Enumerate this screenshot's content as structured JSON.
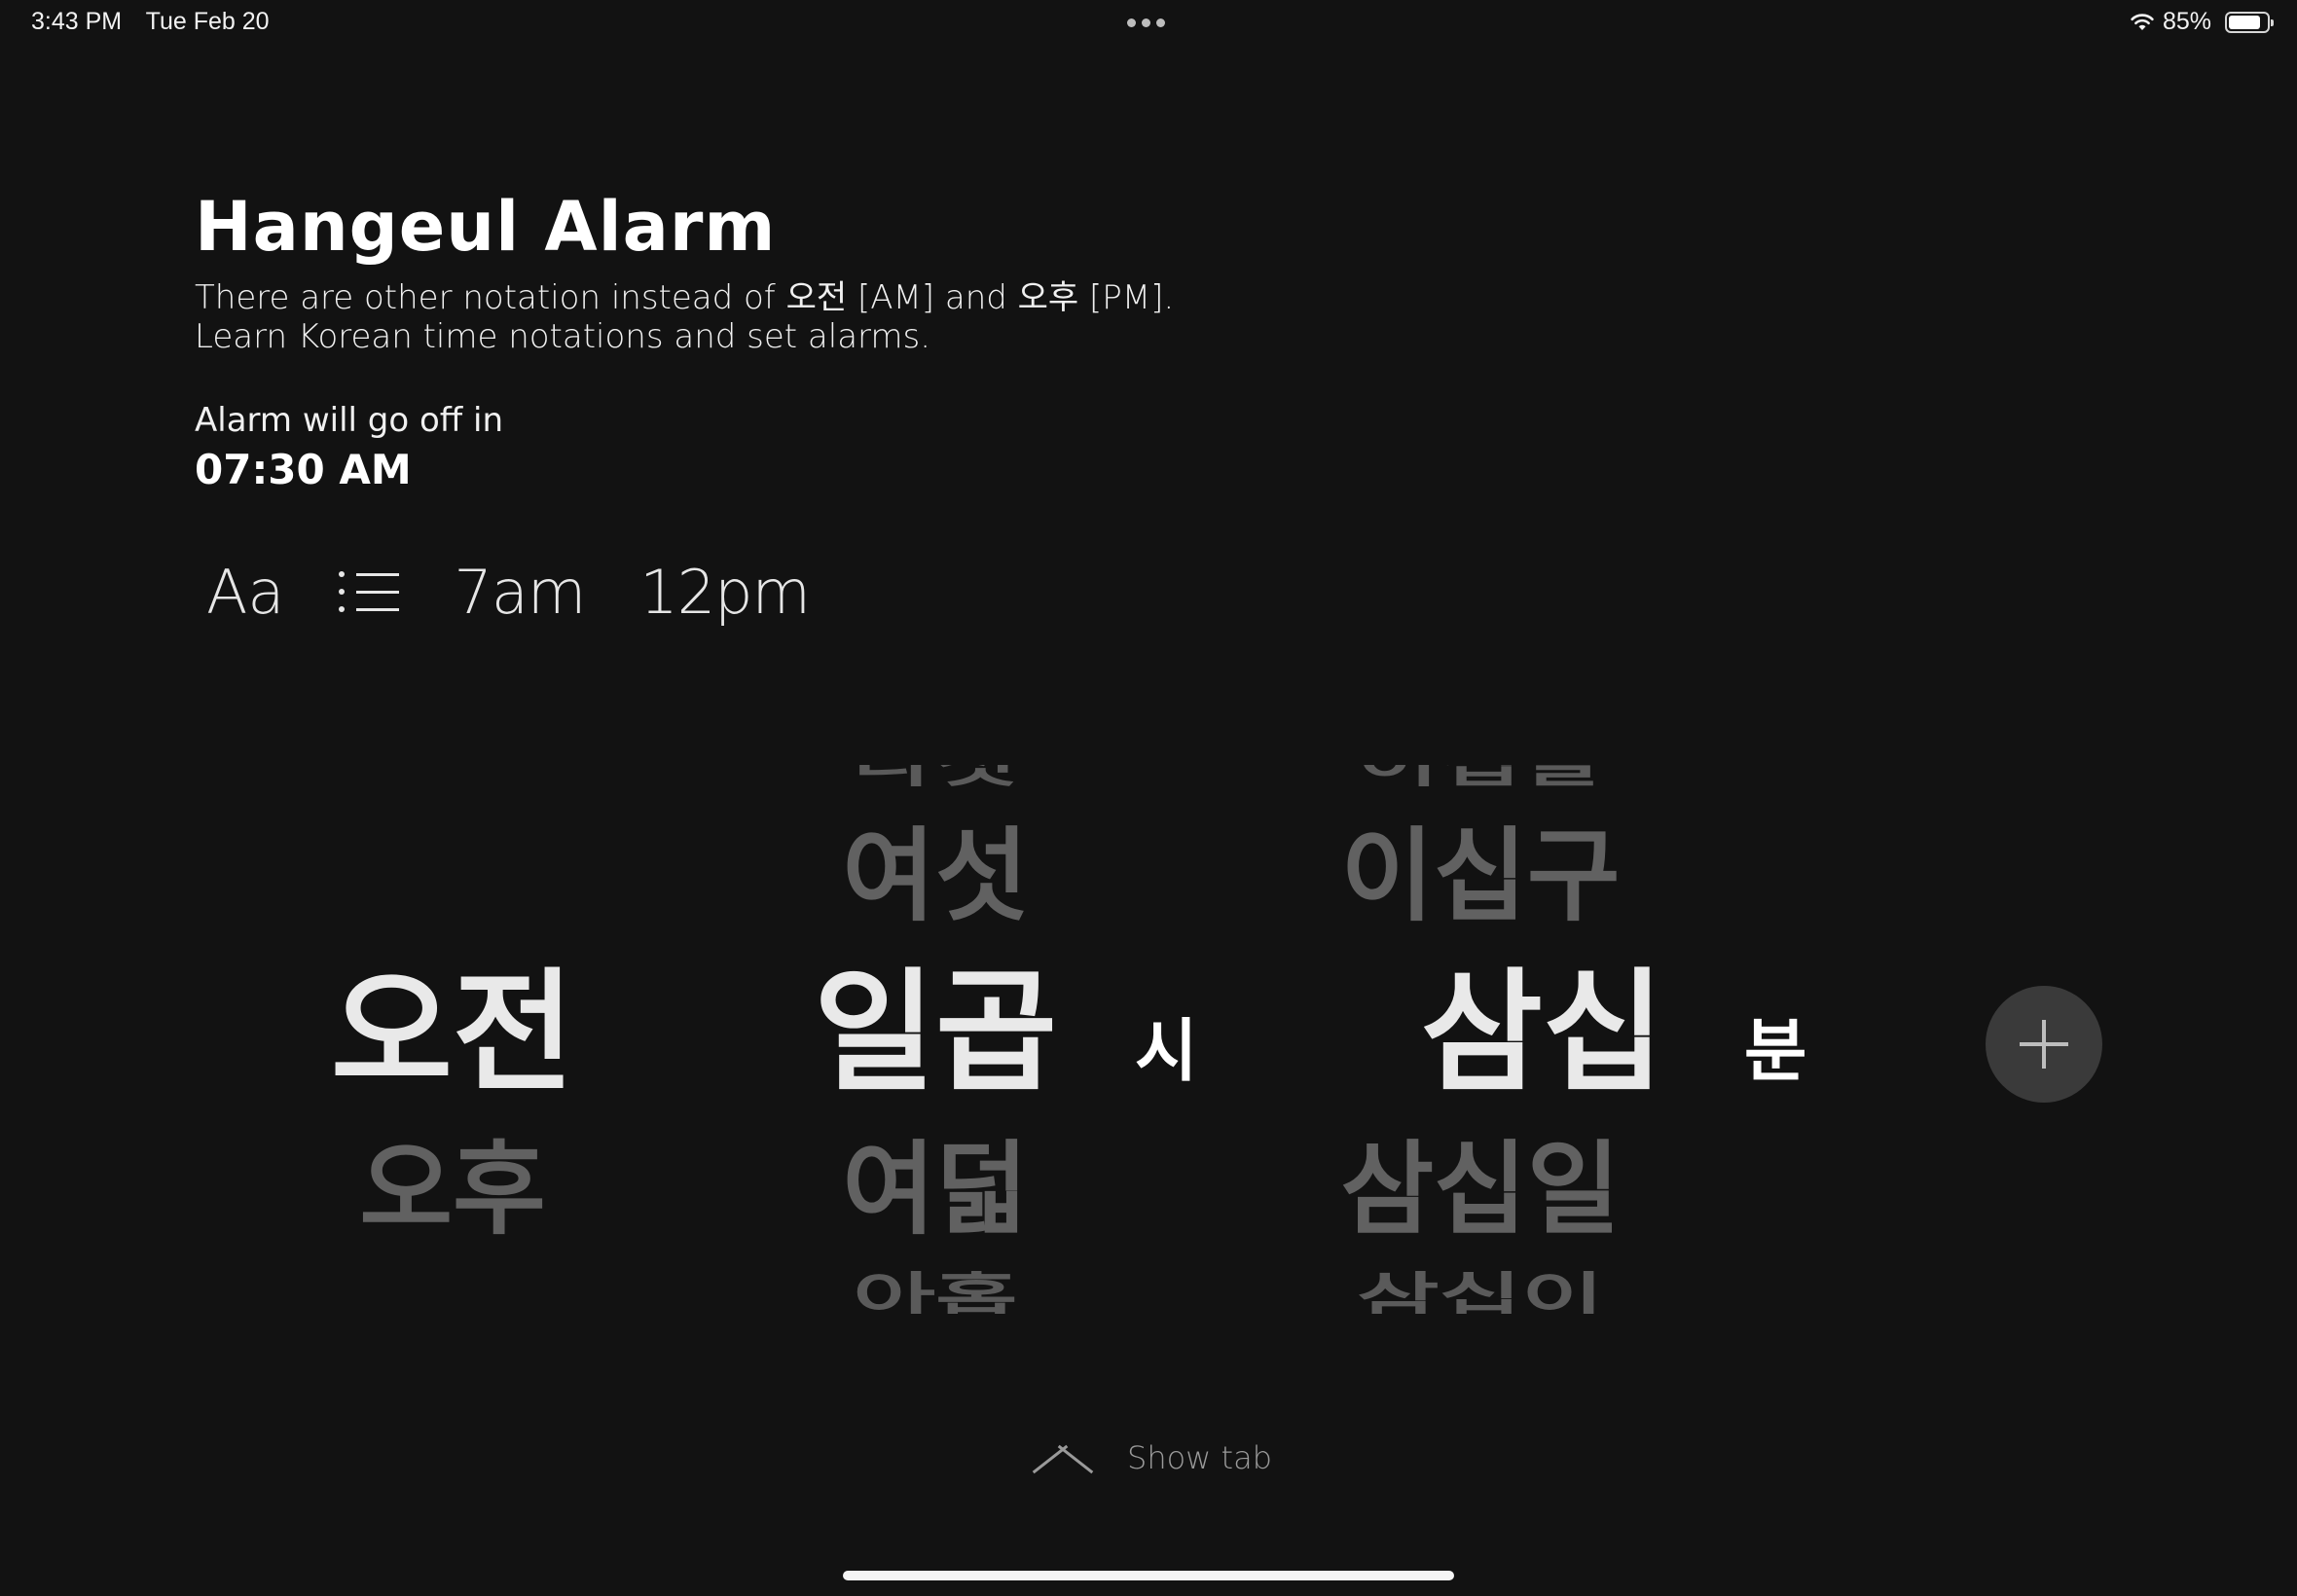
{
  "status_bar": {
    "time": "3:43 PM",
    "date": "Tue Feb 20",
    "battery_percent": "85%",
    "battery_level": 0.85
  },
  "header": {
    "title": "Hangeul Alarm",
    "description_line1": "There are other notation instead of 오전 [AM] and 오후 [PM].",
    "description_line2": "Learn Korean time notations and set alarms."
  },
  "alarm": {
    "caption": "Alarm will go off in",
    "time": "07:30 AM"
  },
  "toolbar": {
    "font_label": "Aa",
    "preset_1": "7am",
    "preset_2": "12pm"
  },
  "picker": {
    "period": {
      "selected": "오전",
      "below": "오후"
    },
    "hour": {
      "far_above": "다섯",
      "above": "여섯",
      "selected": "일곱",
      "below": "여덟",
      "far_below": "아홉",
      "unit": "시"
    },
    "minute": {
      "far_above": "이십팔",
      "above": "이십구",
      "selected": "삼십",
      "below": "삼십일",
      "far_below": "삼십이",
      "unit": "분"
    }
  },
  "show_tab_label": "Show tab",
  "icons": {
    "wifi": "wifi-icon",
    "battery": "battery-icon",
    "list": "list-icon",
    "add": "plus-icon",
    "chevron": "chevron-up-icon"
  }
}
